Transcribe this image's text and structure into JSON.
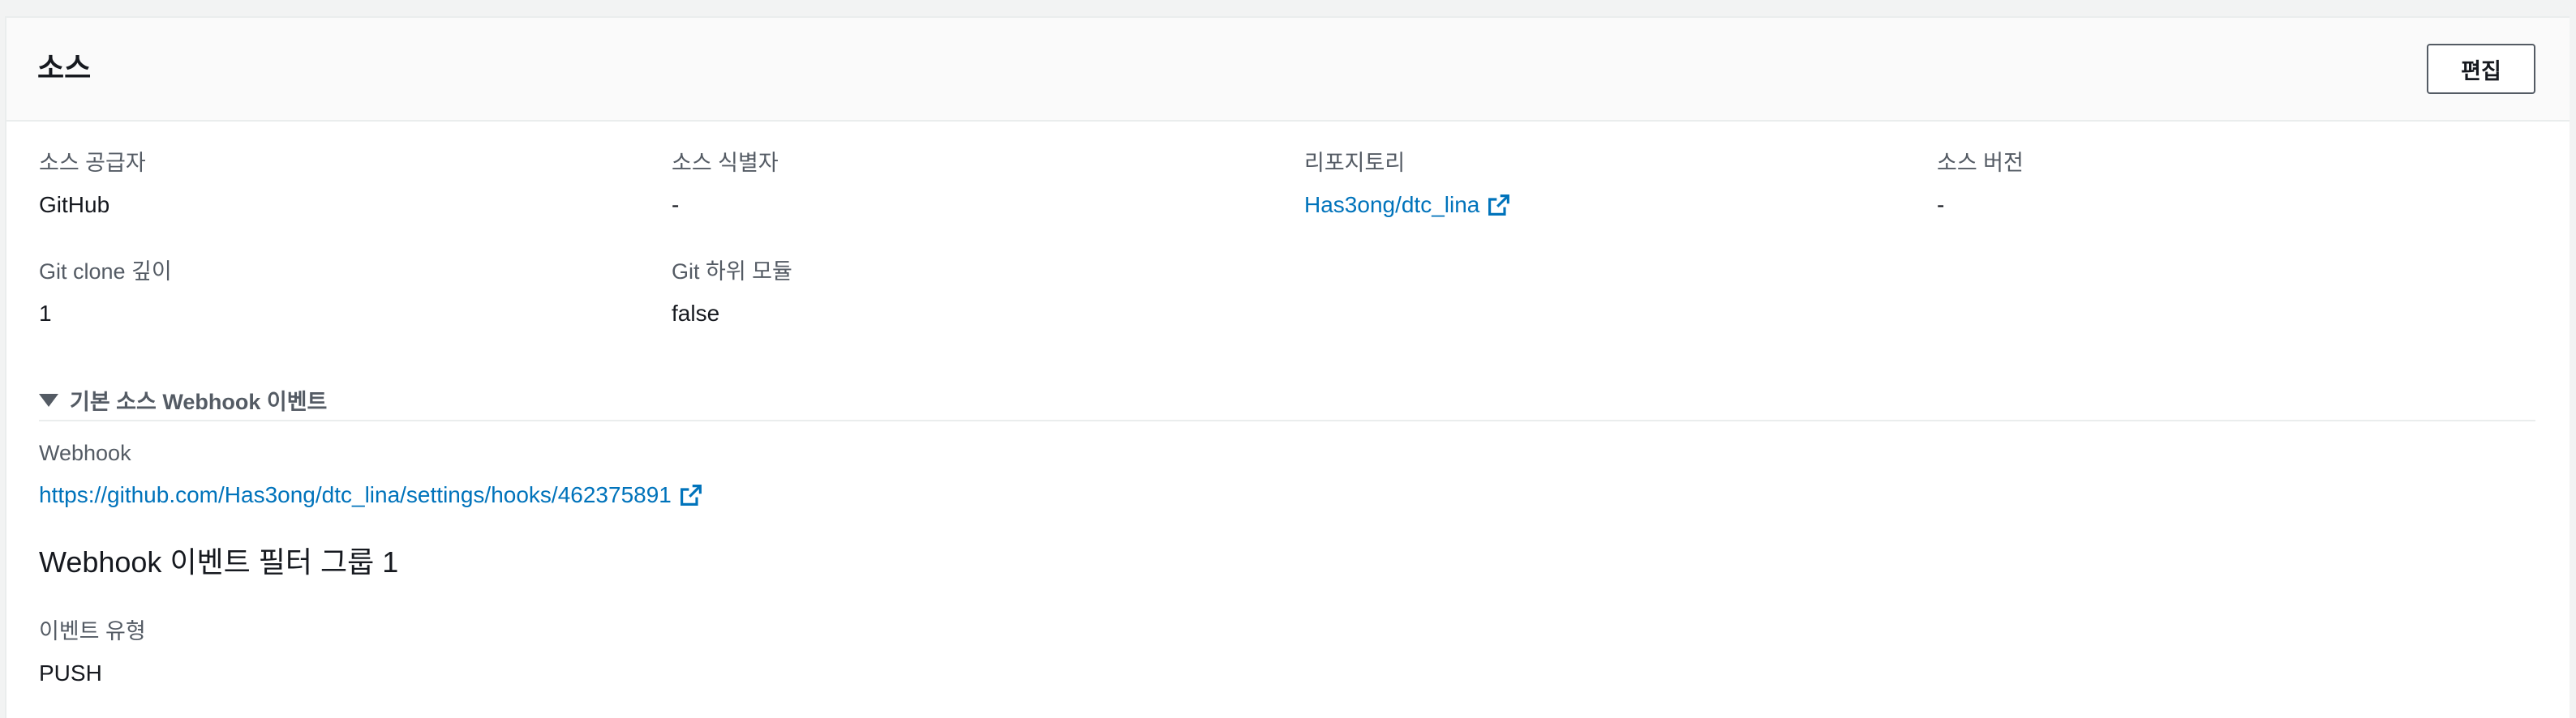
{
  "panel": {
    "title": "소스",
    "edit_label": "편집"
  },
  "fields": {
    "source_provider": {
      "label": "소스 공급자",
      "value": "GitHub"
    },
    "source_identifier": {
      "label": "소스 식별자",
      "value": "-"
    },
    "repository": {
      "label": "리포지토리",
      "value": "Has3ong/dtc_lina"
    },
    "source_version": {
      "label": "소스 버전",
      "value": "-"
    },
    "git_clone_depth": {
      "label": "Git clone 깊이",
      "value": "1"
    },
    "git_submodules": {
      "label": "Git 하위 모듈",
      "value": "false"
    }
  },
  "webhook_section": {
    "toggle_label": "기본 소스 Webhook 이벤트",
    "webhook_label": "Webhook",
    "webhook_url": "https://github.com/Has3ong/dtc_lina/settings/hooks/462375891",
    "filter_group_heading": "Webhook 이벤트 필터 그룹 1",
    "event_type_label": "이벤트 유형",
    "event_type_value": "PUSH"
  },
  "colors": {
    "link": "#0073bb",
    "label": "#545b64",
    "text": "#16191f",
    "border": "#eaeded"
  },
  "icons": {
    "external_link": "external-link-icon",
    "caret": "caret-down-icon"
  }
}
